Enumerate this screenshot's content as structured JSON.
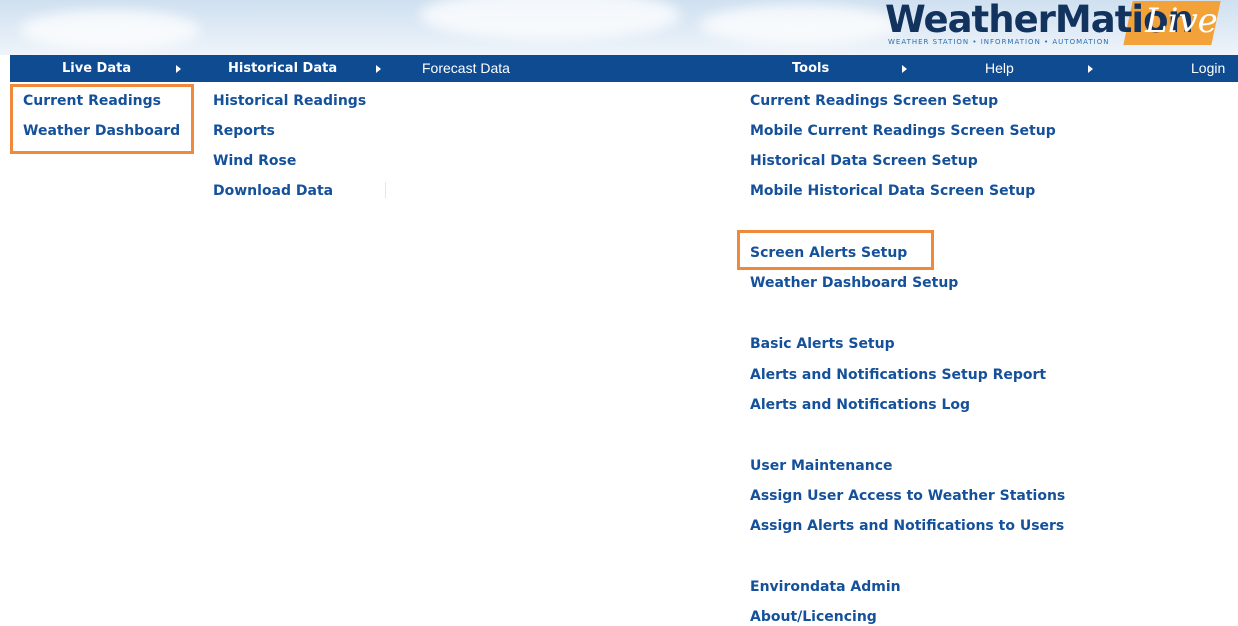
{
  "logo": {
    "brand": "WeatherMation",
    "live": "Live",
    "tagline": "WEATHER STATION • INFORMATION • AUTOMATION",
    "colors": {
      "brand": "#12335e",
      "live_bg": "#f3a23a"
    }
  },
  "nav": {
    "live_data": "Live Data",
    "historical_data": "Historical Data",
    "forecast_data": "Forecast Data",
    "tools": "Tools",
    "help": "Help",
    "login": "Login",
    "colors": {
      "bar": "#0e4b91",
      "text": "#ffffff"
    }
  },
  "live_menu": {
    "items": [
      "Current Readings",
      "Weather Dashboard"
    ]
  },
  "historical_menu": {
    "items": [
      "Historical Readings",
      "Reports",
      "Wind Rose",
      "Download Data"
    ]
  },
  "tools_menu": {
    "groups": [
      [
        "Current Readings Screen Setup",
        "Mobile Current Readings Screen Setup",
        "Historical Data Screen Setup",
        "Mobile Historical Data Screen Setup"
      ],
      [
        "Screen Alerts Setup",
        "Weather Dashboard Setup"
      ],
      [
        "Basic Alerts Setup",
        "Alerts and Notifications Setup Report",
        "Alerts and Notifications Log"
      ],
      [
        "User Maintenance",
        "Assign User Access to Weather Stations",
        "Assign Alerts and Notifications to Users"
      ],
      [
        "Environdata Admin",
        "About/Licencing"
      ]
    ]
  },
  "colors": {
    "link": "#15519b",
    "highlight": "#ef8a3c"
  }
}
